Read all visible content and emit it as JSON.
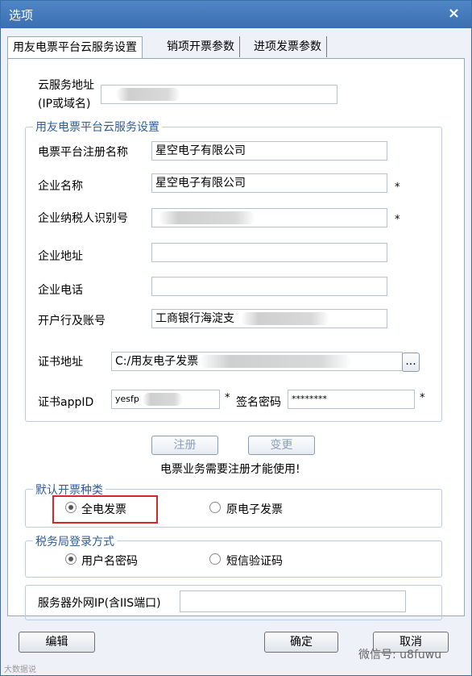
{
  "window": {
    "title": "选项",
    "close_glyph": "×"
  },
  "tabs": [
    {
      "label": "用友电票平台云服务设置"
    },
    {
      "label": "销项开票参数"
    },
    {
      "label": "进项发票参数"
    }
  ],
  "cloud": {
    "label_line1": "云服务地址",
    "label_line2": "(IP或域名)",
    "value": ""
  },
  "settings_group": {
    "legend": "用友电票平台云服务设置",
    "reg_name_label": "电票平台注册名称",
    "reg_name_value": "星空电子有限公司",
    "company_label": "企业名称",
    "company_value": "星空电子有限公司",
    "taxid_label": "企业纳税人识别号",
    "taxid_value": "",
    "address_label": "企业地址",
    "address_value": "",
    "phone_label": "企业电话",
    "phone_value": "",
    "bank_label": "开户行及账号",
    "bank_value": "工商银行海淀支",
    "cert_label": "证书地址",
    "cert_value": "C:/用友电子发票",
    "browse_label": "...",
    "appid_label": "证书appID",
    "appid_value": "yesfp",
    "sign_label": "签名密码",
    "sign_value": "********",
    "required_mark": "*"
  },
  "actions": {
    "register_label": "注册",
    "change_label": "变更",
    "notice": "电票业务需要注册才能使用!"
  },
  "invoice_type_group": {
    "legend": "默认开票种类",
    "option1": "全电发票",
    "option2": "原电子发票",
    "selected": "全电发票"
  },
  "login_group": {
    "legend": "税务局登录方式",
    "option1": "用户名密码",
    "option2": "短信验证码",
    "selected": "用户名密码"
  },
  "server": {
    "label": "服务器外网IP(含IIS端口)",
    "value": ""
  },
  "footer": {
    "edit_label": "编辑",
    "ok_label": "确定",
    "cancel_label": "取消"
  },
  "watermarks": {
    "right": "微信号: u8fuwu",
    "left": "大数据说"
  }
}
